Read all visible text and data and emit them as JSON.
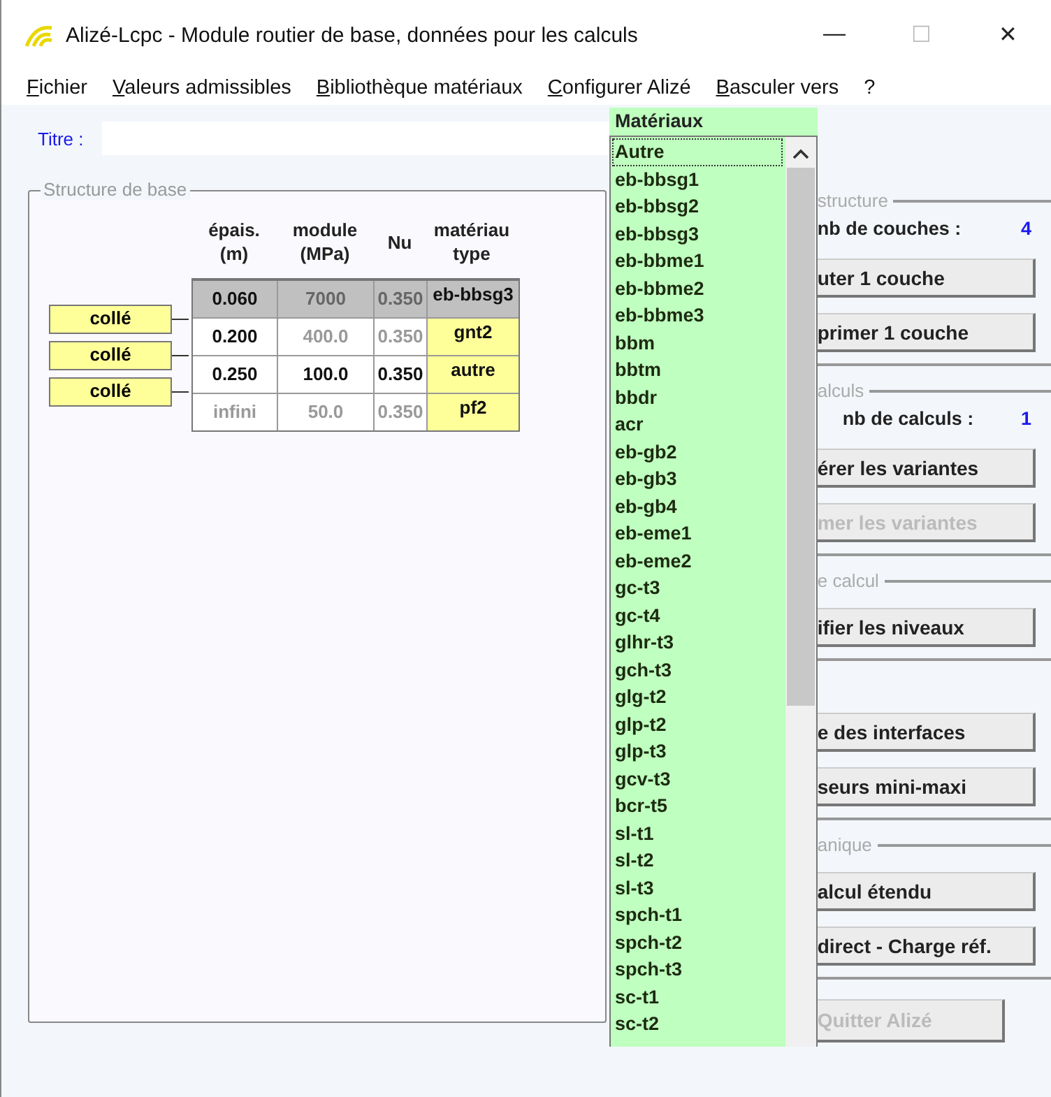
{
  "window": {
    "title": "Alizé-Lcpc - Module routier de base, données pour les calculs",
    "controls": [
      "—",
      "☐",
      "✕"
    ]
  },
  "menu": [
    {
      "label": "Fichier",
      "underline": true
    },
    {
      "label": "Valeurs admissibles",
      "underline": true
    },
    {
      "label": "Bibliothèque matériaux",
      "underline": true
    },
    {
      "label": "Configurer Alizé",
      "underline": true
    },
    {
      "label": "Basculer vers",
      "underline": true
    },
    {
      "label": "?",
      "underline": false
    }
  ],
  "title_field": {
    "label": "Titre :"
  },
  "structure": {
    "title": "Structure de base",
    "columns": [
      {
        "lines": [
          "épais.",
          "(m)"
        ]
      },
      {
        "lines": [
          "module",
          "(MPa)"
        ]
      },
      {
        "lines": [
          "Nu"
        ]
      },
      {
        "lines": [
          "matériau",
          "type"
        ]
      }
    ],
    "rows": [
      {
        "selected": true,
        "cells": [
          {
            "text": "0.060",
            "active": true
          },
          {
            "text": "7000",
            "active": false
          },
          {
            "text": "0.350",
            "active": false
          }
        ],
        "material": "eb-bbsg3"
      },
      {
        "selected": false,
        "cells": [
          {
            "text": "0.200",
            "active": true
          },
          {
            "text": "400.0",
            "active": false
          },
          {
            "text": "0.350",
            "active": false
          }
        ],
        "material": "gnt2"
      },
      {
        "selected": false,
        "cells": [
          {
            "text": "0.250",
            "active": true
          },
          {
            "text": "100.0",
            "active": true
          },
          {
            "text": "0.350",
            "active": true
          }
        ],
        "material": "autre"
      },
      {
        "selected": false,
        "cells": [
          {
            "text": "infini",
            "active": false
          },
          {
            "text": "50.0",
            "active": false
          },
          {
            "text": "0.350",
            "active": false
          }
        ],
        "material": "pf2"
      }
    ],
    "interfaces": [
      {
        "label": "collé"
      },
      {
        "label": "collé"
      },
      {
        "label": "collé"
      }
    ]
  },
  "dropdown": {
    "header": "Matériaux",
    "items": [
      {
        "label": "Autre",
        "focused": true
      },
      {
        "label": "eb-bbsg1",
        "focused": false
      },
      {
        "label": "eb-bbsg2",
        "focused": false
      },
      {
        "label": "eb-bbsg3",
        "focused": false
      },
      {
        "label": "eb-bbme1",
        "focused": false
      },
      {
        "label": "eb-bbme2",
        "focused": false
      },
      {
        "label": "eb-bbme3",
        "focused": false
      },
      {
        "label": "bbm",
        "focused": false
      },
      {
        "label": "bbtm",
        "focused": false
      },
      {
        "label": "bbdr",
        "focused": false
      },
      {
        "label": "acr",
        "focused": false
      },
      {
        "label": "eb-gb2",
        "focused": false
      },
      {
        "label": "eb-gb3",
        "focused": false
      },
      {
        "label": "eb-gb4",
        "focused": false
      },
      {
        "label": "eb-eme1",
        "focused": false
      },
      {
        "label": "eb-eme2",
        "focused": false
      },
      {
        "label": "gc-t3",
        "focused": false
      },
      {
        "label": "gc-t4",
        "focused": false
      },
      {
        "label": "glhr-t3",
        "focused": false
      },
      {
        "label": "gch-t3",
        "focused": false
      },
      {
        "label": "glg-t2",
        "focused": false
      },
      {
        "label": "glp-t2",
        "focused": false
      },
      {
        "label": "glp-t3",
        "focused": false
      },
      {
        "label": "gcv-t3",
        "focused": false
      },
      {
        "label": "bcr-t5",
        "focused": false
      },
      {
        "label": "sl-t1",
        "focused": false
      },
      {
        "label": "sl-t2",
        "focused": false
      },
      {
        "label": "sl-t3",
        "focused": false
      },
      {
        "label": "spch-t1",
        "focused": false
      },
      {
        "label": "spch-t2",
        "focused": false
      },
      {
        "label": "spch-t3",
        "focused": false
      },
      {
        "label": "sc-t1",
        "focused": false
      },
      {
        "label": "sc-t2",
        "focused": false
      }
    ]
  },
  "right_panel": {
    "sections": [
      {
        "title": "structure",
        "info": {
          "label": "nb de couches :",
          "value": "4"
        },
        "buttons": [
          {
            "label": "uter 1 couche",
            "disabled": false
          },
          {
            "label": "primer 1 couche",
            "disabled": false
          }
        ]
      },
      {
        "title": "alculs",
        "info": {
          "label": "nb de calculs :",
          "value": "1"
        },
        "buttons": [
          {
            "label": "érer les variantes",
            "disabled": false
          },
          {
            "label": "mer les variantes",
            "disabled": true
          }
        ]
      },
      {
        "title": "e calcul",
        "buttons": [
          {
            "label": "ifier les niveaux",
            "disabled": false
          }
        ]
      },
      {
        "buttons": [
          {
            "label": "e des interfaces",
            "disabled": false
          },
          {
            "label": "seurs mini-maxi",
            "disabled": false
          }
        ]
      },
      {
        "title": "anique",
        "buttons": [
          {
            "label": "alcul étendu",
            "disabled": false
          },
          {
            "label": "direct - Charge réf.",
            "disabled": false
          }
        ]
      }
    ],
    "quit": {
      "label": "Quitter Alizé",
      "disabled": true
    }
  }
}
